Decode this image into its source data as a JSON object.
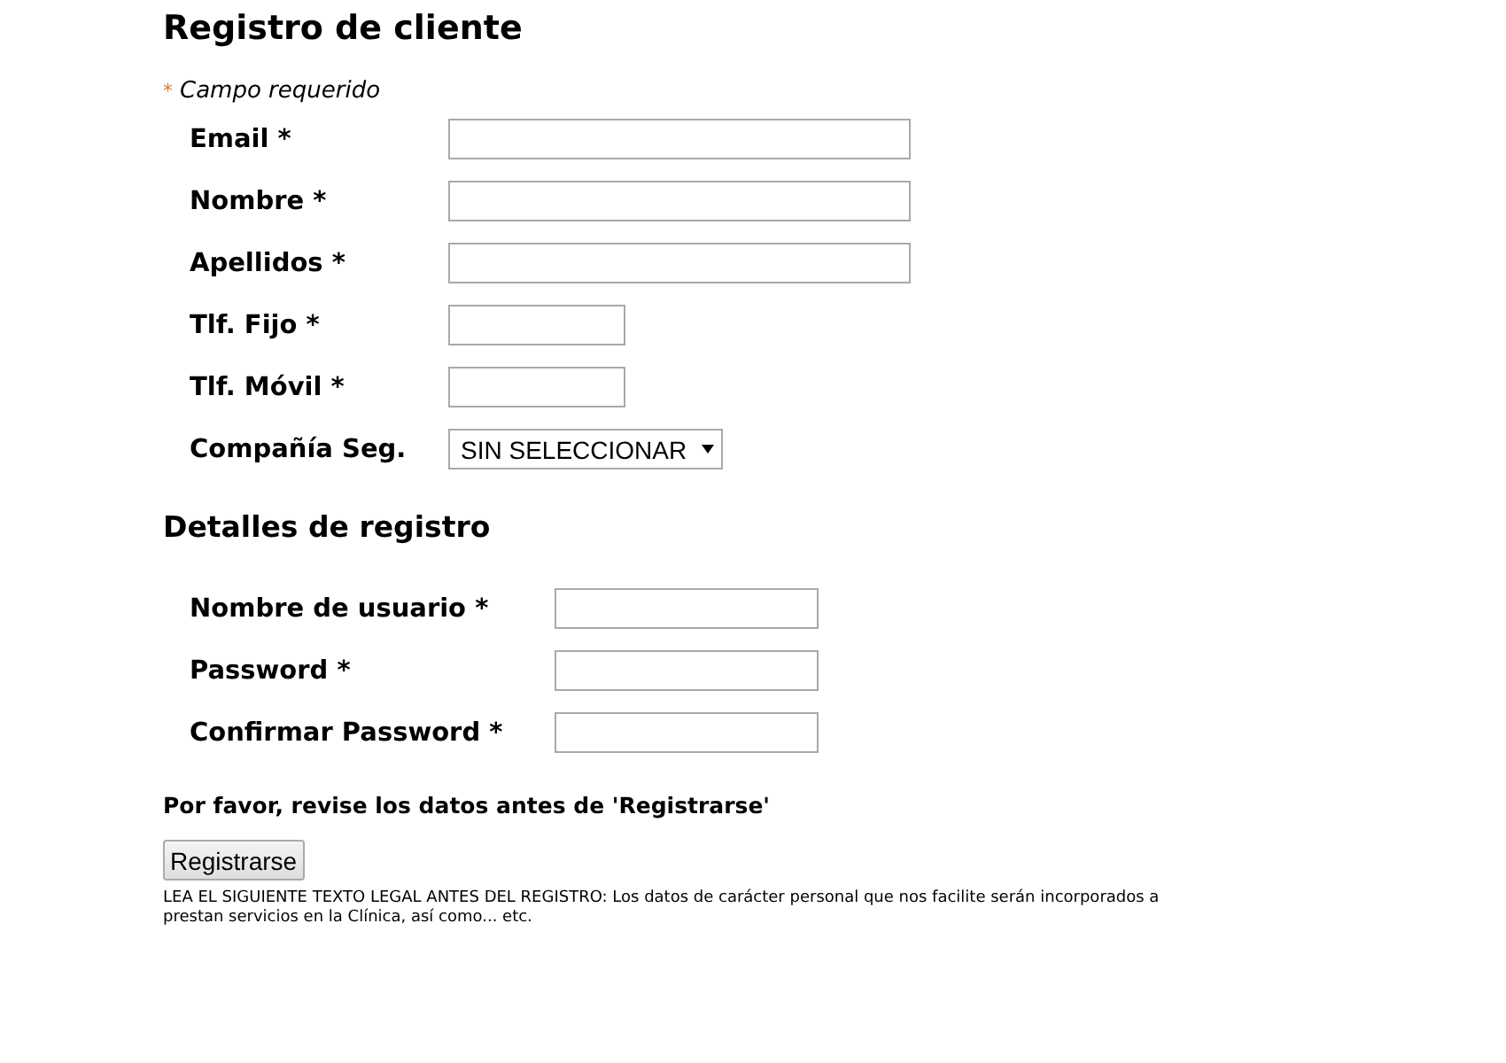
{
  "title": "Registro de cliente",
  "required_note": {
    "mark": "*",
    "text": "Campo requerido"
  },
  "client_fields": [
    {
      "label": "Email *",
      "kind": "text"
    },
    {
      "label": "Nombre *",
      "kind": "text"
    },
    {
      "label": "Apellidos *",
      "kind": "text"
    },
    {
      "label": "Tlf. Fijo *",
      "kind": "phone"
    },
    {
      "label": "Tlf. Móvil *",
      "kind": "phone"
    },
    {
      "label": "Compañía Seg.",
      "kind": "select",
      "value": "SIN SELECCIONAR"
    }
  ],
  "section_title": "Detalles de registro",
  "account_fields": [
    {
      "label": "Nombre de usuario *",
      "kind": "text"
    },
    {
      "label": "Password *",
      "kind": "text"
    },
    {
      "label": "Confirmar Password *",
      "kind": "text"
    }
  ],
  "review_note": "Por favor, revise los datos antes de 'Registrarse'",
  "submit_button": "Registrarse",
  "legal_text": [
    "LEA EL SIGUIENTE TEXTO LEGAL ANTES DEL REGISTRO: Los datos de carácter personal que nos facilite serán incorporados a",
    "prestan servicios en la Clínica, así como... etc."
  ]
}
